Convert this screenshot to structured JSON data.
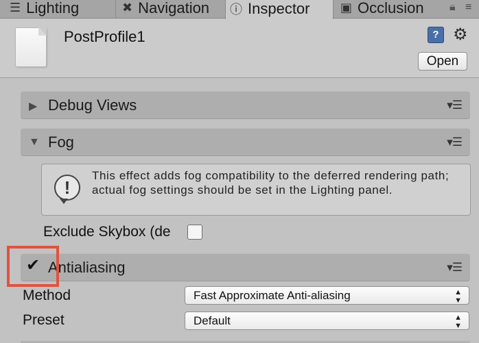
{
  "tabs": [
    {
      "label": "Lighting",
      "icon": "sliders-icon"
    },
    {
      "label": "Navigation",
      "icon": "navigation-icon"
    },
    {
      "label": "Inspector",
      "icon": "info-icon",
      "active": true
    },
    {
      "label": "Occlusion",
      "icon": "occlusion-icon"
    }
  ],
  "header": {
    "name": "PostProfile1",
    "open_label": "Open"
  },
  "sections": {
    "debug_views": "Debug Views",
    "fog": "Fog",
    "antialiasing": "Antialiasing"
  },
  "fog": {
    "help_text": "This effect adds fog compatibility to the deferred rendering path; actual fog settings should be set in the Lighting panel.",
    "exclude_skybox_label": "Exclude Skybox (de",
    "exclude_skybox_checked": false
  },
  "antialiasing": {
    "enabled": true,
    "method_label": "Method",
    "method_value": "Fast Approximate Anti-aliasing",
    "preset_label": "Preset",
    "preset_value": "Default"
  },
  "colors": {
    "highlight": "#e0533f",
    "background": "#c2c2c2",
    "section": "#aeaeae"
  }
}
